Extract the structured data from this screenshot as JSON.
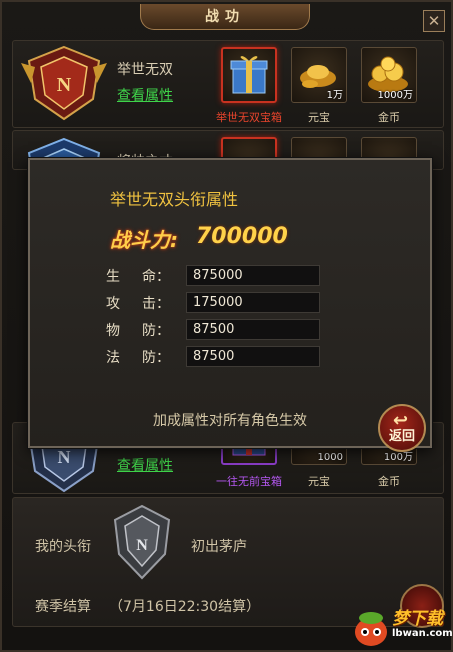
{
  "window": {
    "title": "战功",
    "close_glyph": "✕"
  },
  "rows": [
    {
      "rank_name": "举世无双",
      "view_link": "查看属性",
      "rewards": [
        {
          "label": "举世无双宝箱",
          "qty": "",
          "icon": "gift-box-icon",
          "label_color": "red",
          "selected": true
        },
        {
          "label": "元宝",
          "qty": "1万",
          "icon": "gold-ingot-icon"
        },
        {
          "label": "金币",
          "qty": "1000万",
          "icon": "gold-coins-icon"
        }
      ]
    },
    {
      "rank_name": "将帅之才",
      "view_link": "查看属性",
      "rewards": []
    },
    {
      "rank_name": "",
      "view_link": "查看属性",
      "rewards": [
        {
          "label": "一往无前宝箱",
          "qty": "",
          "icon": "gift-box-icon",
          "label_color": "purple"
        },
        {
          "label": "元宝",
          "qty": "1000",
          "icon": "gold-ingot-icon"
        },
        {
          "label": "金币",
          "qty": "100万",
          "icon": "gold-coins-icon"
        }
      ]
    }
  ],
  "popup": {
    "title": "举世无双头衔属性",
    "power_label": "战斗力:",
    "power_value": "700000",
    "stats": [
      {
        "c1": "生",
        "c2": "命：",
        "value": "875000"
      },
      {
        "c1": "攻",
        "c2": "击：",
        "value": "175000"
      },
      {
        "c1": "物",
        "c2": "防：",
        "value": "87500"
      },
      {
        "c1": "法",
        "c2": "防：",
        "value": "87500"
      }
    ],
    "note": "加成属性对所有角色生效",
    "return_label": "返回"
  },
  "footer": {
    "my_title_label": "我的头衔",
    "my_title_value": "初出茅庐",
    "season_label": "赛季结算",
    "season_time": "（7月16日22:30结算）"
  },
  "watermark": {
    "name": "梦下载",
    "url": "lbwan.com"
  },
  "colors": {
    "accent_gold": "#f0c240",
    "link_green": "#3fd34a",
    "box_red": "#e8442c",
    "box_purple": "#b357ef"
  }
}
